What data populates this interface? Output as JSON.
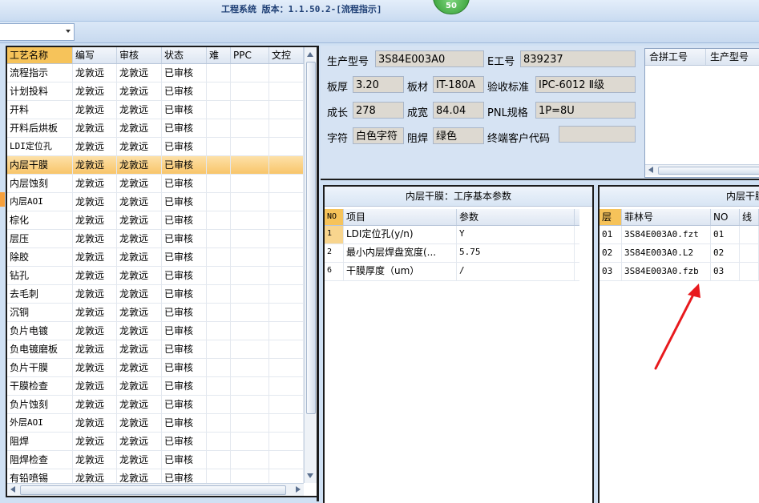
{
  "window": {
    "title": "工程系统 版本：1.1.50.2-[流程指示]",
    "badge": "50"
  },
  "toolbar": {
    "combo_value": ""
  },
  "process_grid": {
    "columns": [
      "工艺名称",
      "编写",
      "审核",
      "状态",
      "难",
      "PPC",
      "文控"
    ],
    "selected_index": 5,
    "rows": [
      [
        "流程指示",
        "龙敦远",
        "龙敦远",
        "已审核"
      ],
      [
        "计划投料",
        "龙敦远",
        "龙敦远",
        "已审核"
      ],
      [
        "开料",
        "龙敦远",
        "龙敦远",
        "已审核"
      ],
      [
        "开料后烘板",
        "龙敦远",
        "龙敦远",
        "已审核"
      ],
      [
        "LDI定位孔",
        "龙敦远",
        "龙敦远",
        "已审核"
      ],
      [
        "内层干膜",
        "龙敦远",
        "龙敦远",
        "已审核"
      ],
      [
        "内层蚀刻",
        "龙敦远",
        "龙敦远",
        "已审核"
      ],
      [
        "内层AOI",
        "龙敦远",
        "龙敦远",
        "已审核"
      ],
      [
        "棕化",
        "龙敦远",
        "龙敦远",
        "已审核"
      ],
      [
        "层压",
        "龙敦远",
        "龙敦远",
        "已审核"
      ],
      [
        "除胶",
        "龙敦远",
        "龙敦远",
        "已审核"
      ],
      [
        "钻孔",
        "龙敦远",
        "龙敦远",
        "已审核"
      ],
      [
        "去毛刺",
        "龙敦远",
        "龙敦远",
        "已审核"
      ],
      [
        "沉铜",
        "龙敦远",
        "龙敦远",
        "已审核"
      ],
      [
        "负片电镀",
        "龙敦远",
        "龙敦远",
        "已审核"
      ],
      [
        "负电镀磨板",
        "龙敦远",
        "龙敦远",
        "已审核"
      ],
      [
        "负片干膜",
        "龙敦远",
        "龙敦远",
        "已审核"
      ],
      [
        "干膜检查",
        "龙敦远",
        "龙敦远",
        "已审核"
      ],
      [
        "负片蚀刻",
        "龙敦远",
        "龙敦远",
        "已审核"
      ],
      [
        "外层AOI",
        "龙敦远",
        "龙敦远",
        "已审核"
      ],
      [
        "阻焊",
        "龙敦远",
        "龙敦远",
        "已审核"
      ],
      [
        "阻焊检查",
        "龙敦远",
        "龙敦远",
        "已审核"
      ],
      [
        "有铅喷锡",
        "龙敦远",
        "龙敦远",
        "已审核"
      ]
    ]
  },
  "info": {
    "model_label": "生产型号",
    "model_value": "3S84E003A0",
    "eno_label": "E工号",
    "eno_value": "839237",
    "thick_label": "板厚",
    "thick_value": "3.20",
    "material_label": "板材",
    "material_value": "IT-180A",
    "std_label": "验收标准",
    "std_value": "IPC-6012 Ⅱ级",
    "len_label": "成长",
    "len_value": "278",
    "wid_label": "成宽",
    "wid_value": "84.04",
    "pnl_label": "PNL规格",
    "pnl_value": "1P=8U",
    "char_label": "字符",
    "char_value": "白色字符",
    "mask_label": "阻焊",
    "mask_value": "绿色",
    "cust_label": "终端客户代码",
    "cust_value": ""
  },
  "merge_table": {
    "columns": [
      "合拼工号",
      "生产型号"
    ]
  },
  "param_panel": {
    "title": "内层干膜：工序基本参数",
    "columns": [
      "NO",
      "项目",
      "参数"
    ],
    "rows": [
      [
        "1",
        "LDI定位孔(y/n)",
        "Y"
      ],
      [
        "2",
        "最小内层焊盘宽度(...",
        "5.75"
      ],
      [
        "6",
        "干膜厚度（um）",
        "/"
      ]
    ]
  },
  "file_panel": {
    "title": "内层干膜",
    "columns": [
      "层",
      "菲林号",
      "NO",
      "线"
    ],
    "rows": [
      [
        "01",
        "3S84E003A0.fzt",
        "01",
        ""
      ],
      [
        "02",
        "3S84E003A0.L2",
        "02",
        ""
      ],
      [
        "03",
        "3S84E003A0.fzb",
        "03",
        ""
      ]
    ]
  },
  "colors": {
    "selected_row": "#f8c56a",
    "annotation_arrow": "#e8191d",
    "badge": "#2f9a2f"
  }
}
